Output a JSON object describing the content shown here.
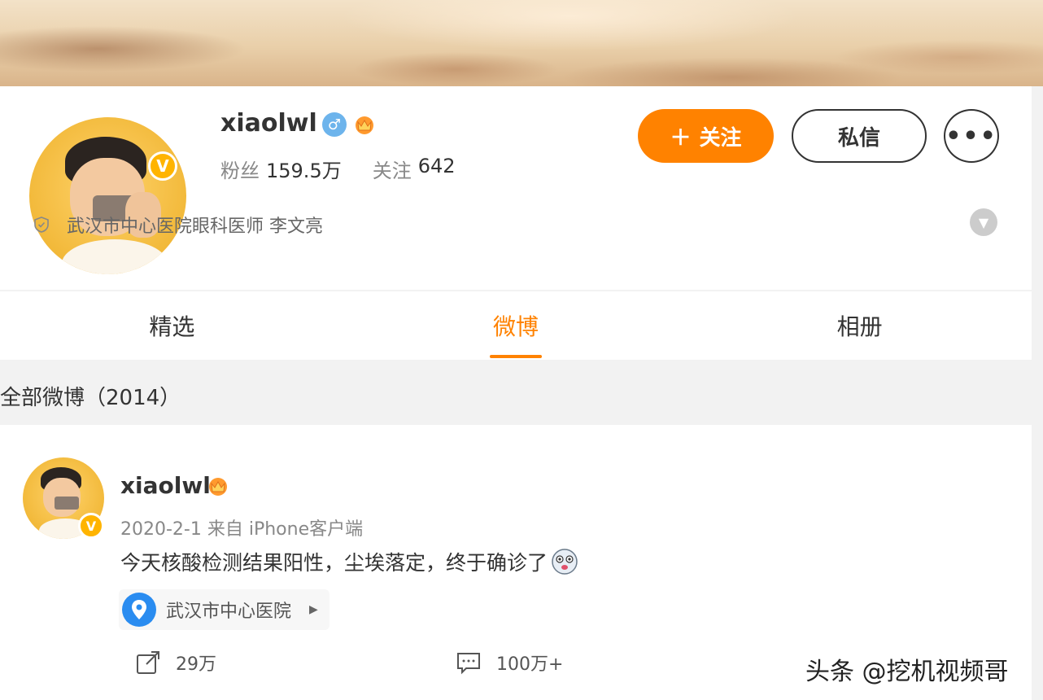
{
  "profile": {
    "username": "xiaolwl",
    "gender_icon": "male-icon",
    "fans_label": "粉丝",
    "fans_value": "159.5万",
    "following_label": "关注",
    "following_value": "642",
    "follow_button": "关注",
    "message_button": "私信",
    "more_button": "•••",
    "verification": "武汉市中心医院眼科医师 李文亮",
    "verified_badge": "V"
  },
  "tabs": [
    {
      "label": "精选",
      "active": false
    },
    {
      "label": "微博",
      "active": true
    },
    {
      "label": "相册",
      "active": false
    }
  ],
  "section_title": "全部微博（2014）",
  "post": {
    "username": "xiaolwl",
    "meta": "2020-2-1 来自 iPhone客户端",
    "text": "今天核酸检测结果阳性，尘埃落定，终于确诊了",
    "location": "武汉市中心医院",
    "reposts": "29万",
    "comments": "100万+",
    "verified_badge": "V"
  },
  "watermark": "头条 @挖机视频哥",
  "colors": {
    "accent": "#ff8200",
    "badge": "#ffb400",
    "location_pin": "#2a8cf0"
  }
}
